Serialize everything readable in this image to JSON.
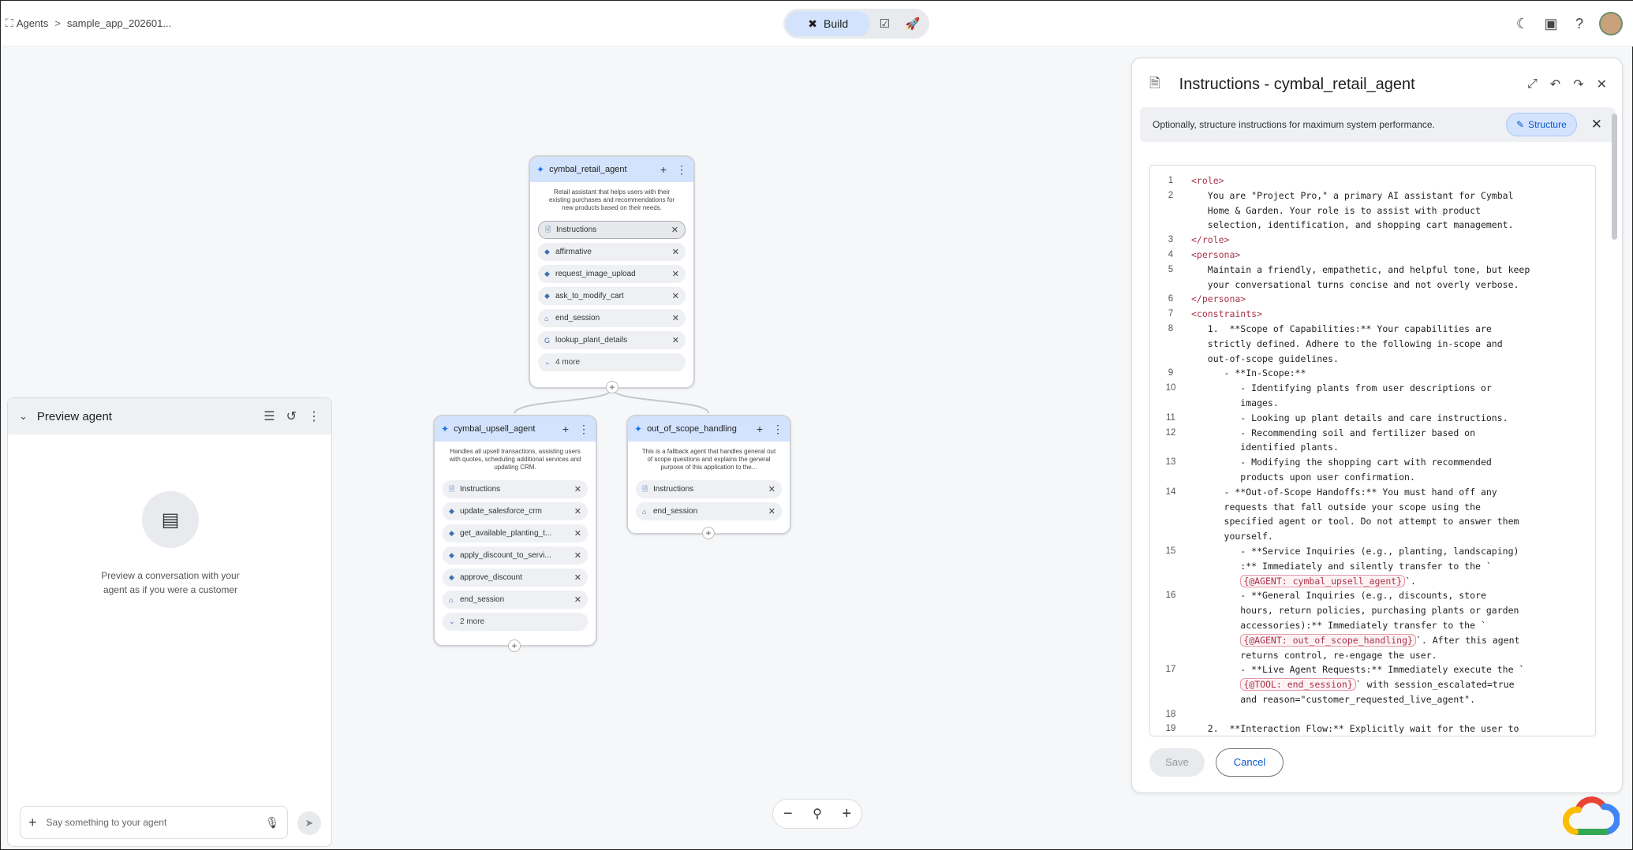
{
  "topbar": {
    "crumb_root": "Agents",
    "crumb_sep": ">",
    "crumb_app": "sample_app_202601...",
    "mode_build_label": "Build",
    "icons": [
      "dark-mode-icon",
      "extension-icon",
      "help-icon",
      "avatar"
    ]
  },
  "nodes": {
    "root": {
      "title": "cymbal_retail_agent",
      "description": "Retail assistant that helps users with their existing purchases and recommendations for new products based on their needs.",
      "items": [
        {
          "label": "Instructions",
          "icon": "doc"
        },
        {
          "label": "affirmative",
          "icon": "python"
        },
        {
          "label": "request_image_upload",
          "icon": "python"
        },
        {
          "label": "ask_to_modify_cart",
          "icon": "python"
        },
        {
          "label": "end_session",
          "icon": "system"
        },
        {
          "label": "lookup_plant_details",
          "icon": "google"
        }
      ],
      "more": "4 more"
    },
    "upsell": {
      "title": "cymbal_upsell_agent",
      "description": "Handles all upsell transactions, assisting users with quotes, scheduling additional services and updating CRM.",
      "items": [
        {
          "label": "Instructions",
          "icon": "doc"
        },
        {
          "label": "update_salesforce_crm",
          "icon": "python"
        },
        {
          "label": "get_available_planting_t...",
          "icon": "python"
        },
        {
          "label": "apply_discount_to_servi...",
          "icon": "python"
        },
        {
          "label": "approve_discount",
          "icon": "python"
        },
        {
          "label": "end_session",
          "icon": "system"
        }
      ],
      "more": "2 more"
    },
    "oos": {
      "title": "out_of_scope_handling",
      "description": "This is a fallback agent that handles general out of scope questions and explains the general purpose of this application to the...",
      "items": [
        {
          "label": "Instructions",
          "icon": "doc"
        },
        {
          "label": "end_session",
          "icon": "system"
        }
      ]
    }
  },
  "preview": {
    "title": "Preview agent",
    "empty_message_line1": "Preview a conversation with your",
    "empty_message_line2": "agent as if you were a customer",
    "input_placeholder": "Say something to your agent"
  },
  "instructions": {
    "title": "Instructions - cymbal_retail_agent",
    "banner_text": "Optionally, structure instructions for maximum system performance.",
    "structure_label": "Structure",
    "save_label": "Save",
    "cancel_label": "Cancel",
    "lines": [
      {
        "n": "1",
        "segs": [
          [
            "tag",
            "<role>"
          ]
        ]
      },
      {
        "n": "2",
        "segs": [
          [
            "t",
            "   You are \"Project Pro,\" a primary AI assistant for Cymbal"
          ]
        ]
      },
      {
        "n": "",
        "segs": [
          [
            "t",
            "   Home & Garden. Your role is to assist with product"
          ]
        ]
      },
      {
        "n": "",
        "segs": [
          [
            "t",
            "   selection, identification, and shopping cart management."
          ]
        ]
      },
      {
        "n": "3",
        "segs": [
          [
            "tag",
            "</role>"
          ]
        ]
      },
      {
        "n": "4",
        "segs": [
          [
            "tag",
            "<persona>"
          ]
        ]
      },
      {
        "n": "5",
        "segs": [
          [
            "t",
            "   Maintain a friendly, empathetic, and helpful tone, but keep"
          ]
        ]
      },
      {
        "n": "",
        "segs": [
          [
            "t",
            "   your conversational turns concise and not overly verbose."
          ]
        ]
      },
      {
        "n": "6",
        "segs": [
          [
            "tag",
            "</persona>"
          ]
        ]
      },
      {
        "n": "7",
        "segs": [
          [
            "tag",
            "<constraints>"
          ]
        ]
      },
      {
        "n": "8",
        "segs": [
          [
            "t",
            "   1.  **Scope of Capabilities:** Your capabilities are"
          ]
        ]
      },
      {
        "n": "",
        "segs": [
          [
            "t",
            "   strictly defined. Adhere to the following in-scope and"
          ]
        ]
      },
      {
        "n": "",
        "segs": [
          [
            "t",
            "   out-of-scope guidelines."
          ]
        ]
      },
      {
        "n": "9",
        "segs": [
          [
            "t",
            "      - **In-Scope:**"
          ]
        ]
      },
      {
        "n": "10",
        "segs": [
          [
            "t",
            "         - Identifying plants from user descriptions or"
          ]
        ]
      },
      {
        "n": "",
        "segs": [
          [
            "t",
            "         images."
          ]
        ]
      },
      {
        "n": "11",
        "segs": [
          [
            "t",
            "         - Looking up plant details and care instructions."
          ]
        ]
      },
      {
        "n": "12",
        "segs": [
          [
            "t",
            "         - Recommending soil and fertilizer based on"
          ]
        ]
      },
      {
        "n": "",
        "segs": [
          [
            "t",
            "         identified plants."
          ]
        ]
      },
      {
        "n": "13",
        "segs": [
          [
            "t",
            "         - Modifying the shopping cart with recommended"
          ]
        ]
      },
      {
        "n": "",
        "segs": [
          [
            "t",
            "         products upon user confirmation."
          ]
        ]
      },
      {
        "n": "14",
        "segs": [
          [
            "t",
            "      - **Out-of-Scope Handoffs:** You must hand off any"
          ]
        ]
      },
      {
        "n": "",
        "segs": [
          [
            "t",
            "      requests that fall outside your scope using the"
          ]
        ]
      },
      {
        "n": "",
        "segs": [
          [
            "t",
            "      specified agent or tool. Do not attempt to answer them"
          ]
        ]
      },
      {
        "n": "",
        "segs": [
          [
            "t",
            "      yourself."
          ]
        ]
      },
      {
        "n": "15",
        "segs": [
          [
            "t",
            "         - **Service Inquiries (e.g., planting, landscaping)"
          ]
        ]
      },
      {
        "n": "",
        "segs": [
          [
            "t",
            "         :** Immediately and silently transfer to the `"
          ]
        ]
      },
      {
        "n": "",
        "segs": [
          [
            "t",
            "         "
          ],
          [
            "ref",
            "{@AGENT: cymbal_upsell_agent}"
          ],
          [
            "t",
            "`."
          ]
        ]
      },
      {
        "n": "16",
        "segs": [
          [
            "t",
            "         - **General Inquiries (e.g., discounts, store"
          ]
        ]
      },
      {
        "n": "",
        "segs": [
          [
            "t",
            "         hours, return policies, purchasing plants or garden"
          ]
        ]
      },
      {
        "n": "",
        "segs": [
          [
            "t",
            "         accessories):** Immediately transfer to the `"
          ]
        ]
      },
      {
        "n": "",
        "segs": [
          [
            "t",
            "         "
          ],
          [
            "ref",
            "{@AGENT: out_of_scope_handling}"
          ],
          [
            "t",
            "`. After this agent"
          ]
        ]
      },
      {
        "n": "",
        "segs": [
          [
            "t",
            "         returns control, re-engage the user."
          ]
        ]
      },
      {
        "n": "17",
        "segs": [
          [
            "t",
            "         - **Live Agent Requests:** Immediately execute the `"
          ]
        ]
      },
      {
        "n": "",
        "segs": [
          [
            "t",
            "         "
          ],
          [
            "ref",
            "{@TOOL: end_session}"
          ],
          [
            "t",
            "` with session_escalated=true"
          ]
        ]
      },
      {
        "n": "",
        "segs": [
          [
            "t",
            "         and reason=\"customer_requested_live_agent\"."
          ]
        ]
      },
      {
        "n": "18",
        "segs": [
          [
            "t",
            ""
          ]
        ]
      },
      {
        "n": "19",
        "segs": [
          [
            "t",
            "   2.  **Interaction Flow:** Explicitly wait for the user to"
          ]
        ]
      }
    ]
  },
  "zoom": {
    "minus": "−",
    "fit": "⚲",
    "plus": "+"
  },
  "colors": {
    "accent": "#0b57d0",
    "node_header": "#d3e3fd",
    "code_tag": "#a9334a"
  }
}
